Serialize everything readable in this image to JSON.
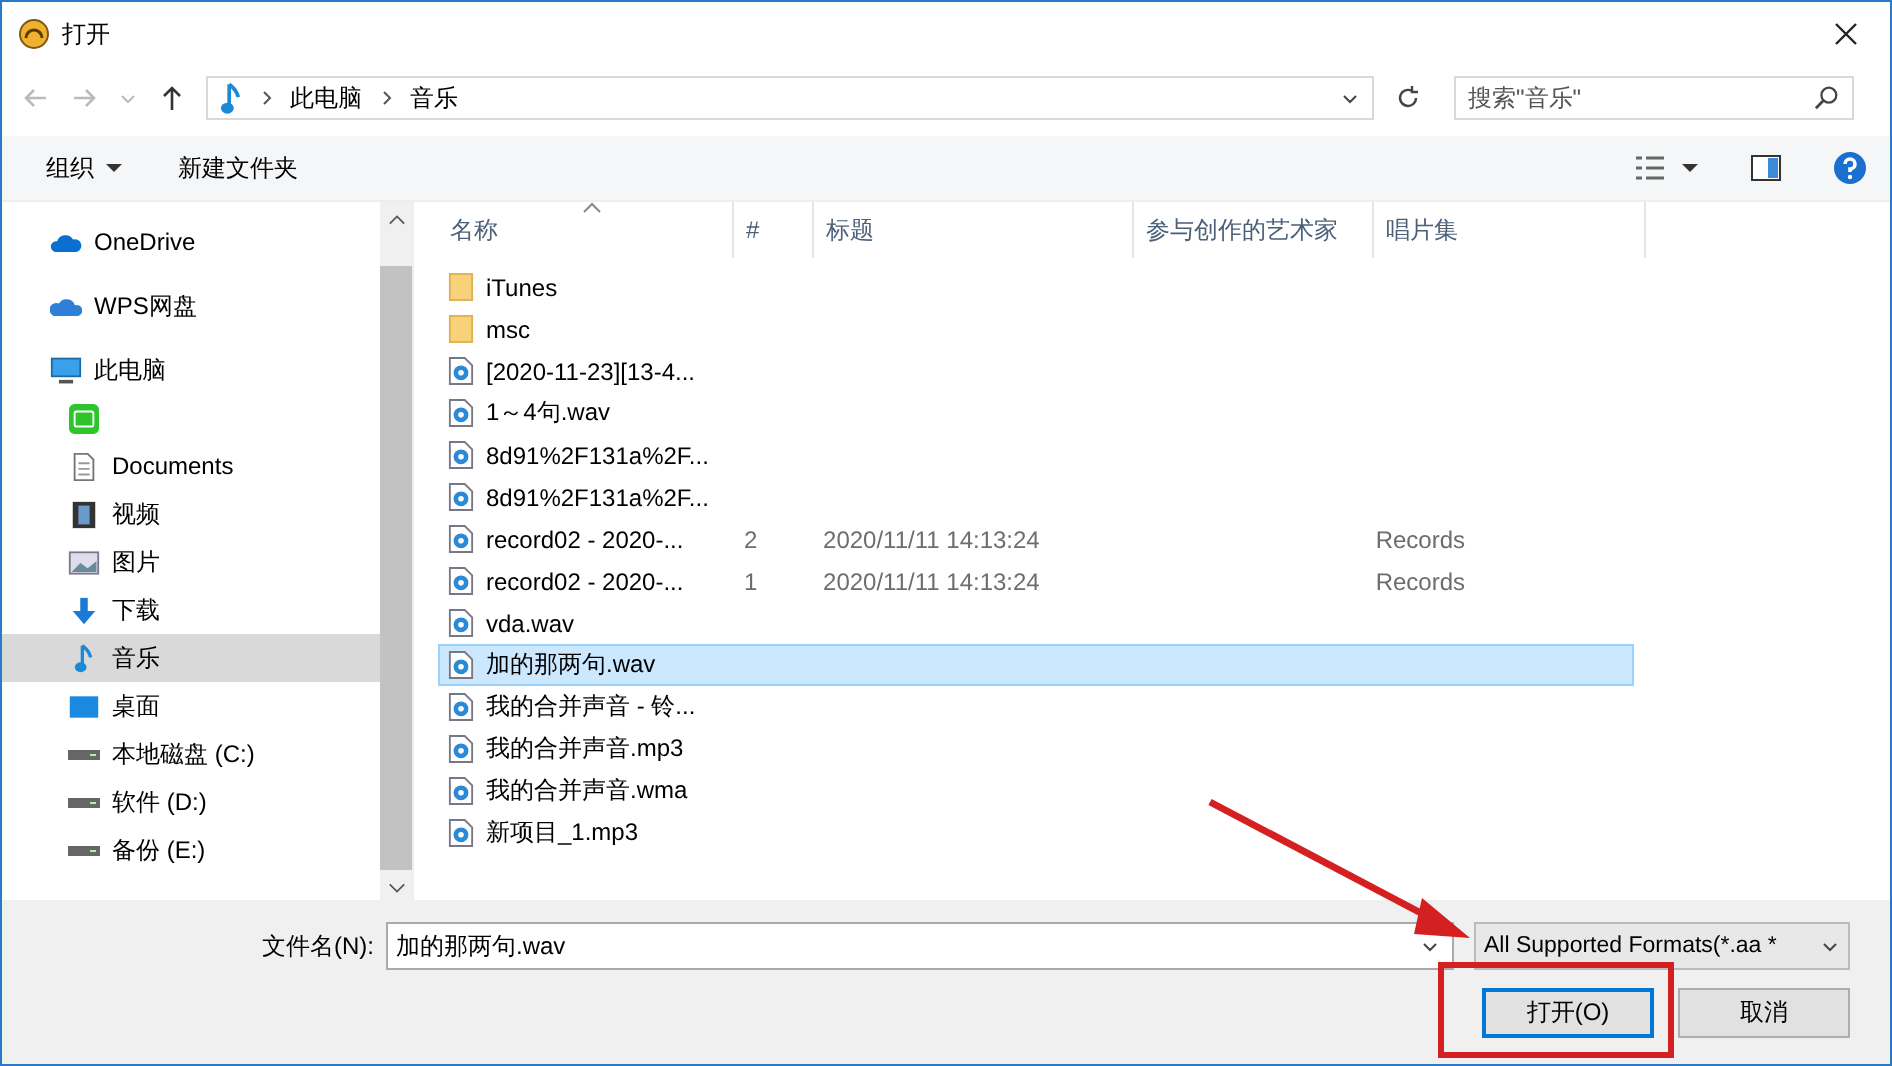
{
  "window": {
    "title": "打开"
  },
  "address_bar": {
    "path": [
      "此电脑",
      "音乐"
    ],
    "search_placeholder": "搜索\"音乐\""
  },
  "toolbar": {
    "organize": "组织",
    "new_folder": "新建文件夹"
  },
  "sidebar": {
    "items": [
      {
        "label": "OneDrive",
        "kind": "cloud",
        "selected": false
      },
      {
        "label": "WPS网盘",
        "kind": "cloud2",
        "selected": false
      },
      {
        "label": "此电脑",
        "kind": "computer",
        "selected": false,
        "children": [
          {
            "kind": "app",
            "selected": false
          },
          {
            "label": "Documents",
            "kind": "document",
            "selected": false
          },
          {
            "label": "视频",
            "kind": "video",
            "selected": false
          },
          {
            "label": "图片",
            "kind": "picture",
            "selected": false
          },
          {
            "label": "下载",
            "kind": "download",
            "selected": false
          },
          {
            "label": "音乐",
            "kind": "music",
            "selected": true
          },
          {
            "label": "桌面",
            "kind": "desktop",
            "selected": false
          },
          {
            "label": "本地磁盘 (C:)",
            "kind": "drive",
            "selected": false
          },
          {
            "label": "软件 (D:)",
            "kind": "drive",
            "selected": false
          },
          {
            "label": "备份 (E:)",
            "kind": "drive",
            "selected": false
          }
        ]
      }
    ]
  },
  "table": {
    "columns": [
      "名称",
      "#",
      "标题",
      "参与创作的艺术家",
      "唱片集"
    ],
    "rows": [
      {
        "name": "iTunes",
        "kind": "folder",
        "selected": false
      },
      {
        "name": "msc",
        "kind": "folder",
        "selected": false
      },
      {
        "name": "[2020-11-23][13-4...",
        "kind": "audio",
        "selected": false
      },
      {
        "name": "1～4句.wav",
        "kind": "audio",
        "selected": false
      },
      {
        "name": "8d91%2F131a%2F...",
        "kind": "audio",
        "selected": false
      },
      {
        "name": "8d91%2F131a%2F...",
        "kind": "audio",
        "selected": false
      },
      {
        "name": "record02 - 2020-...",
        "kind": "audio",
        "selected": false,
        "track": "2",
        "title": "2020/11/11 14:13:24",
        "album": "Records"
      },
      {
        "name": "record02 - 2020-...",
        "kind": "audio",
        "selected": false,
        "track": "1",
        "title": "2020/11/11 14:13:24",
        "album": "Records"
      },
      {
        "name": "vda.wav",
        "kind": "audio",
        "selected": false
      },
      {
        "name": "加的那两句.wav",
        "kind": "audio",
        "selected": true
      },
      {
        "name": "我的合并声音 - 铃...",
        "kind": "audio",
        "selected": false
      },
      {
        "name": "我的合并声音.mp3",
        "kind": "audio",
        "selected": false
      },
      {
        "name": "我的合并声音.wma",
        "kind": "audio",
        "selected": false
      },
      {
        "name": "新项目_1.mp3",
        "kind": "audio",
        "selected": false
      }
    ]
  },
  "footer": {
    "filename_label": "文件名(N):",
    "filename": "加的那两句.wav",
    "filter": "All Supported Formats(*.aa *",
    "open_button": "打开(O)",
    "cancel_button": "取消"
  },
  "annotations": {
    "arrow": true,
    "highlight_frame": true
  }
}
